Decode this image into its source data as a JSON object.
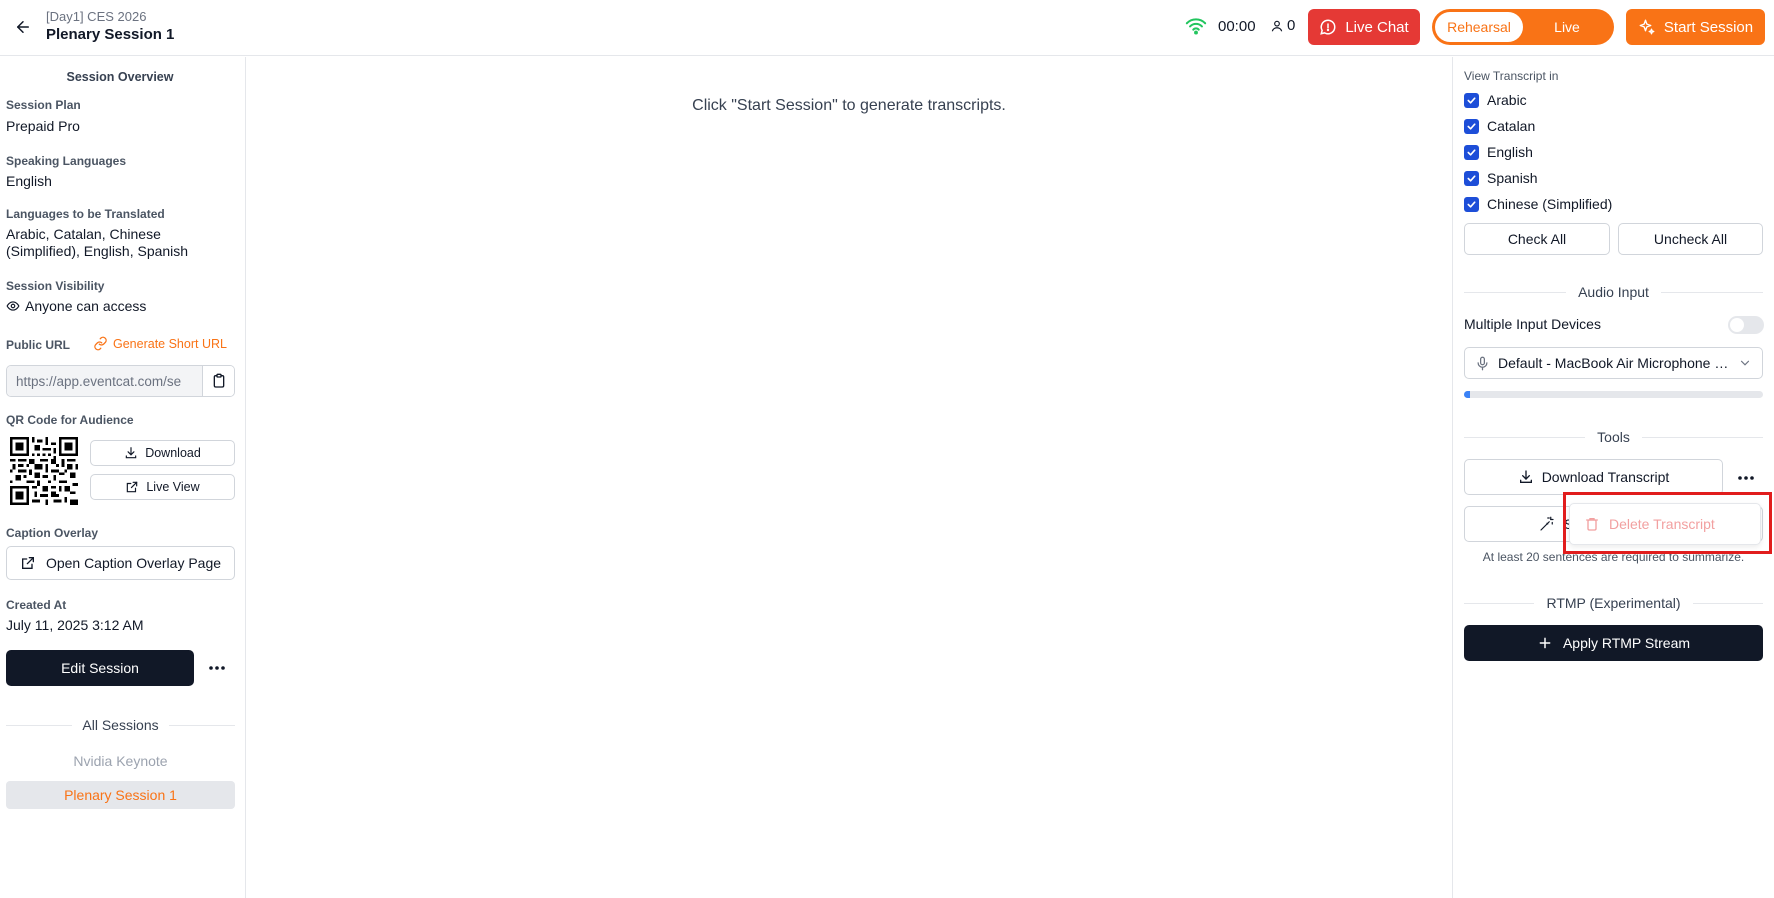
{
  "header": {
    "event_name": "[Day1] CES 2026",
    "session_title": "Plenary Session 1",
    "timer": "00:00",
    "viewer_count": "0",
    "live_chat_label": "Live Chat",
    "mode_options": [
      "Rehearsal",
      "Live"
    ],
    "mode_selected": "Rehearsal",
    "start_label": "Start Session"
  },
  "sidebar": {
    "title": "Session Overview",
    "session_plan_label": "Session Plan",
    "session_plan": "Prepaid Pro",
    "speaking_label": "Speaking Languages",
    "speaking": "English",
    "translated_label": "Languages to be Translated",
    "translated_line1": "Arabic, Catalan, Chinese",
    "translated_line2": "(Simplified), English, Spanish",
    "visibility_label": "Session Visibility",
    "visibility": "Anyone can access",
    "public_url_label": "Public URL",
    "generate_short_url": "Generate Short URL",
    "public_url": "https://app.eventcat.com/se",
    "qr_label": "QR Code for Audience",
    "download_label": "Download",
    "live_view_label": "Live View",
    "caption_label": "Caption Overlay",
    "caption_button": "Open Caption Overlay Page",
    "created_label": "Created At",
    "created_at": "July 11, 2025 3:12 AM",
    "edit_label": "Edit Session",
    "all_sessions_label": "All Sessions",
    "sessions": [
      "Nvidia Keynote",
      "Plenary Session 1"
    ]
  },
  "main": {
    "message": "Click \"Start Session\" to generate transcripts."
  },
  "right_panel": {
    "view_label": "View Transcript in",
    "languages": [
      "Arabic",
      "Catalan",
      "English",
      "Spanish",
      "Chinese (Simplified)"
    ],
    "check_all": "Check All",
    "uncheck_all": "Uncheck All",
    "audio_title": "Audio Input",
    "multi_input_label": "Multiple Input Devices",
    "multi_input_enabled": false,
    "mic_device": "Default - MacBook Air Microphone (Built-in)",
    "audio_level": 0.02,
    "tools_title": "Tools",
    "download_transcript": "Download Transcript",
    "summarize_partial": "S",
    "summarize_note": "At least 20 sentences are required to summarize.",
    "rtmp_title": "RTMP (Experimental)",
    "rtmp_button": "Apply RTMP Stream",
    "dropdown_item": "Delete Transcript"
  },
  "colors": {
    "accent": "#f97316",
    "live_chat": "#e53935",
    "dark": "#111827",
    "checkbox": "#1d4ed8",
    "highlight": "#e11d1d"
  }
}
